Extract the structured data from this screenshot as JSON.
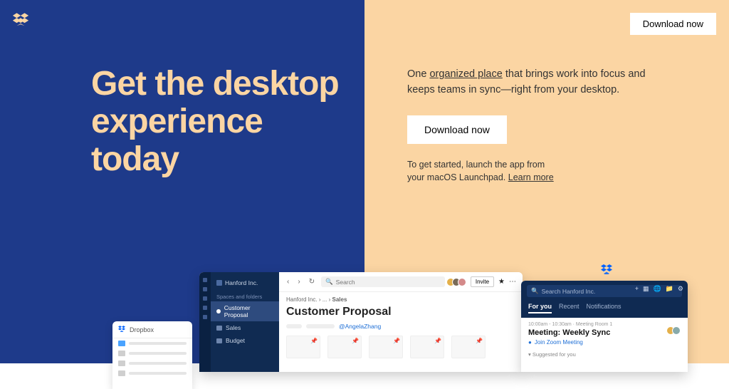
{
  "brand": "Dropbox",
  "colors": {
    "navy": "#1e3a8a",
    "peach": "#fbd5a3"
  },
  "top_download_label": "Download now",
  "hero_title": "Get the desktop experience today",
  "tagline_prefix": "One ",
  "tagline_underlined": "organized place",
  "tagline_suffix": " that brings work into focus and keeps teams in sync—right from your desktop.",
  "mid_download_label": "Download now",
  "hint_prefix": "To get started, launch the app from your macOS Launchpad. ",
  "hint_link": "Learn more",
  "mockups": {
    "finder": {
      "title": "Dropbox"
    },
    "app": {
      "sidebar_breadcrumb": "Hanford Inc.",
      "sidebar_section": "Spaces and folders",
      "sidebar_items": [
        {
          "label": "Customer Proposal",
          "active": true
        },
        {
          "label": "Sales",
          "active": false
        },
        {
          "label": "Budget",
          "active": false
        }
      ],
      "search_placeholder": "Search",
      "invite_label": "Invite",
      "crumb_root": "Hanford Inc.",
      "crumb_leaf": "Sales",
      "doc_title": "Customer Proposal",
      "mention": "@AngelaZhang"
    },
    "tray": {
      "search_placeholder": "Search Hanford Inc.",
      "tabs": [
        "For you",
        "Recent",
        "Notifications"
      ],
      "time_line": "10:00am - 10:30am · Meeting Room 1",
      "meeting_title": "Meeting: Weekly Sync",
      "join_label": "Join Zoom Meeting",
      "suggested_label": "Suggested for you"
    }
  }
}
